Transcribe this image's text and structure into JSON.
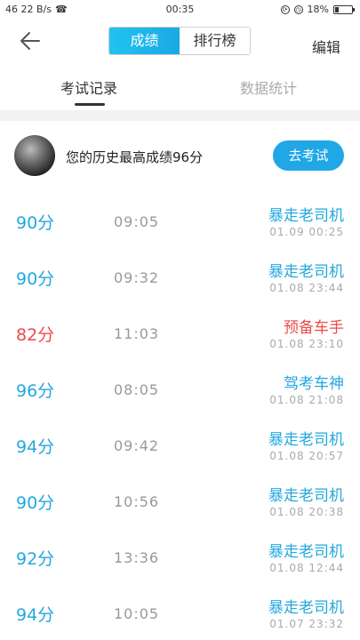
{
  "status_bar": {
    "left": "46 22 B/s",
    "clock": "00:35",
    "battery": "18%"
  },
  "header": {
    "segment": [
      "成绩",
      "排行榜"
    ],
    "edit_label": "编辑"
  },
  "subtabs": [
    "考试记录",
    "数据统计"
  ],
  "profile": {
    "best_text": "您的历史最高成绩96分",
    "go_button": "去考试"
  },
  "colors": {
    "accent": "#1fa7e6",
    "fail": "#ee4a4a"
  },
  "records": [
    {
      "score": "90分",
      "duration": "09:05",
      "title": "暴走老司机",
      "date": "01.09  00:25",
      "status": "pass"
    },
    {
      "score": "90分",
      "duration": "09:32",
      "title": "暴走老司机",
      "date": "01.08  23:44",
      "status": "pass"
    },
    {
      "score": "82分",
      "duration": "11:03",
      "title": "预备车手",
      "date": "01.08  23:10",
      "status": "fail"
    },
    {
      "score": "96分",
      "duration": "08:05",
      "title": "驾考车神",
      "date": "01.08  21:08",
      "status": "pass"
    },
    {
      "score": "94分",
      "duration": "09:42",
      "title": "暴走老司机",
      "date": "01.08  20:57",
      "status": "pass"
    },
    {
      "score": "90分",
      "duration": "10:56",
      "title": "暴走老司机",
      "date": "01.08  20:38",
      "status": "pass"
    },
    {
      "score": "92分",
      "duration": "13:36",
      "title": "暴走老司机",
      "date": "01.08  12:44",
      "status": "pass"
    },
    {
      "score": "94分",
      "duration": "10:05",
      "title": "暴走老司机",
      "date": "01.07  23:32",
      "status": "pass"
    }
  ]
}
